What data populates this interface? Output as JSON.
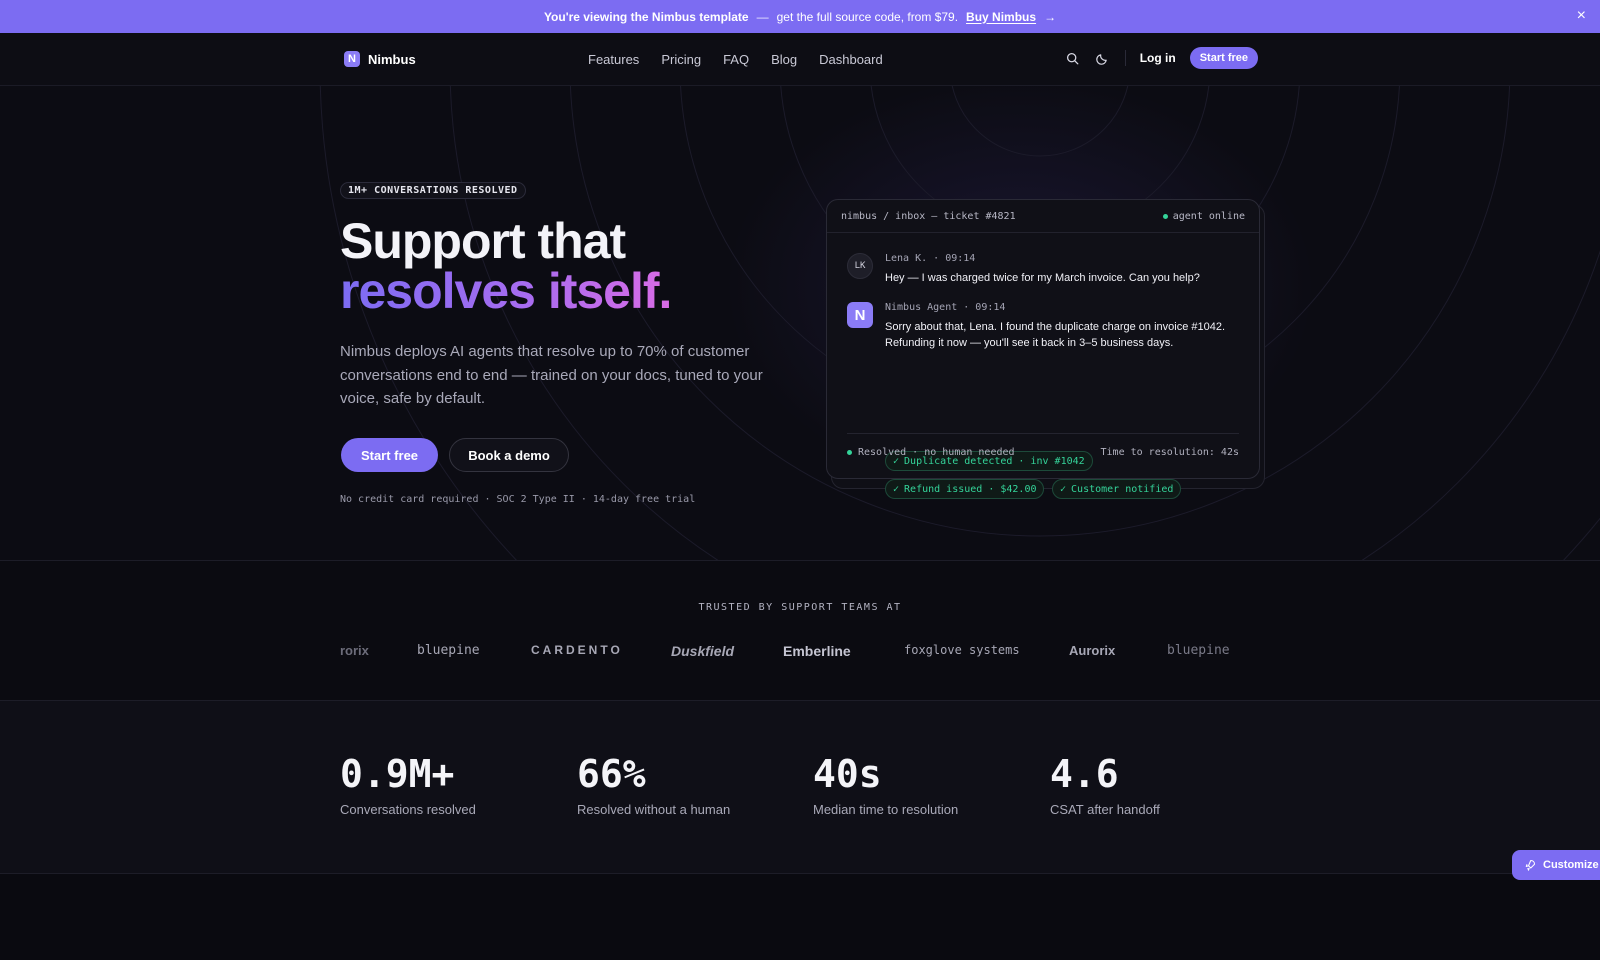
{
  "banner": {
    "highlight": "You're viewing the Nimbus template",
    "dash": "—",
    "text": "get the full source code, from $79.",
    "buy_link": "Buy Nimbus",
    "arrow": "→",
    "close": "×"
  },
  "nav": {
    "brand_letter": "N",
    "brand_name": "Nimbus",
    "links": [
      "Features",
      "Pricing",
      "FAQ",
      "Blog",
      "Dashboard"
    ],
    "login": "Log in",
    "cta": "Start free"
  },
  "hero": {
    "pill": "1M+ CONVERSATIONS RESOLVED",
    "headline_line1": "Support that",
    "headline_line2": "resolves itself.",
    "lede": "Nimbus deploys AI agents that resolve up to 70% of customer conversations end to end — trained on your docs, tuned to your voice, safe by default.",
    "cta_primary": "Start free",
    "cta_secondary": "Book a demo",
    "fine_print": "No credit card required · SOC 2 Type II · 14-day free trial"
  },
  "ticket": {
    "path": "nimbus / inbox — ticket #4821",
    "status": "agent online",
    "messages": [
      {
        "avatar": "LK",
        "meta": "Lena K. · 09:14",
        "text": "Hey — I was charged twice for my March invoice. Can you help?"
      },
      {
        "avatar": "N",
        "meta": "Nimbus Agent · 09:14",
        "text": "Sorry about that, Lena. I found the duplicate charge on invoice #1042. Refunding it now — you'll see it back in 3–5 business days."
      }
    ],
    "tags": [
      "Duplicate detected · inv #1042",
      "Refund issued · $42.00",
      "Customer notified"
    ],
    "footer_left": "Resolved · no human needed",
    "footer_right": "Time to resolution: 42s"
  },
  "logos": {
    "heading": "TRUSTED BY SUPPORT TEAMS AT",
    "items": [
      "urorix",
      "bluepine",
      "CARDENTO",
      "Duskfield",
      "Emberline",
      "foxglove systems",
      "Aurorix",
      "bluepine"
    ]
  },
  "stats": [
    {
      "value": "0.9M+",
      "label": "Conversations resolved"
    },
    {
      "value": "66%",
      "label": "Resolved without a human"
    },
    {
      "value": "40s",
      "label": "Median time to resolution"
    },
    {
      "value": "4.6",
      "label": "CSAT after handoff"
    }
  ],
  "customize": "Customize",
  "colors": {
    "accent": "#7c6cf2",
    "success": "#34d399",
    "background": "#0b0b12"
  }
}
